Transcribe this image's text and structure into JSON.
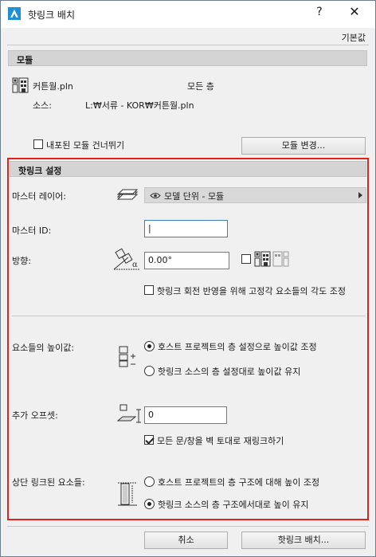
{
  "window": {
    "title": "핫링크 배치",
    "help": "?",
    "close": "✕"
  },
  "preset": "기본값",
  "module_section": {
    "header": "모듈",
    "file_name": "커튼월.pln",
    "floors": "모든 층",
    "source_label": "소스:",
    "source_path": "L:₩서류 - KOR₩커튼월.pln",
    "skip_nested_label": "내포된 모듈 건너뛰기",
    "skip_nested_checked": false,
    "change_module_button": "모듈 변경..."
  },
  "hotlink_settings": {
    "header": "핫링크 설정",
    "master_layer_label": "마스터 레이어:",
    "master_layer_value": "모델 단위 - 모듈",
    "master_id_label": "마스터 ID:",
    "master_id_value": "|",
    "orientation_label": "방향:",
    "angle_value": "0.00°",
    "mirror_checked": false,
    "adjust_angle_label": "핫링크 회전 반영을 위해 고정각 요소들의 각도 조정",
    "adjust_angle_checked": false,
    "elevation_label": "요소들의 높이값:",
    "elevation_options": [
      {
        "label": "호스트 프로젝트의 층 설정으로 높이값 조정",
        "checked": true
      },
      {
        "label": "핫링크 소스의 층 설정대로 높이값 유지",
        "checked": false
      }
    ],
    "offset_label": "추가 오프셋:",
    "offset_value": "0",
    "relink_label": "모든 문/창을 벽 토대로 재링크하기",
    "relink_checked": true,
    "top_linked_label": "상단 링크된 요소들:",
    "top_linked_options": [
      {
        "label": "호스트 프로젝트의 층 구조에 대해 높이 조정",
        "checked": false
      },
      {
        "label": "핫링크 소스의 층 구조에서대로 높이 유지",
        "checked": true
      }
    ]
  },
  "footer": {
    "cancel_button": "취소",
    "place_button": "핫링크 배치..."
  },
  "colors": {
    "highlight_frame": "#e3201b",
    "focus_border": "#3c7fb1",
    "app_icon": "#1f8fd6"
  }
}
